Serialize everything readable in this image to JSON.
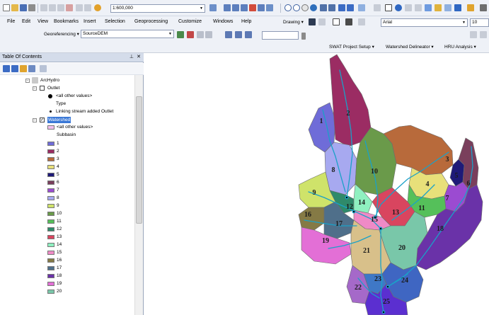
{
  "toolbar": {
    "scale": "1:600,000"
  },
  "menu": [
    "File",
    "Edit",
    "View",
    "Bookmarks",
    "Insert",
    "Selection",
    "Geoprocessing",
    "Customize",
    "Windows",
    "Help"
  ],
  "drawing": {
    "label": "Drawing ▾",
    "font": "Arial",
    "size": "10"
  },
  "georef": {
    "label": "Georeferencing ▾",
    "layer": "SourceDEM"
  },
  "swat": {
    "project_setup": "SWAT Project Setup ▾",
    "delineator": "Watershed Delineator ▾",
    "hru": "HRU Analysis ▾"
  },
  "toc": {
    "title": "Table Of Contents",
    "pin": "⊥",
    "close": "✕",
    "group": "ArcHydro",
    "outlet": {
      "name": "Outlet",
      "all_other": "<all other values>",
      "field": "Type",
      "item": "Linking stream added Outlet"
    },
    "watershed": {
      "name": "Watershed",
      "all_other": "<all other values>",
      "field": "Subbasin",
      "items": [
        {
          "label": "1",
          "color": "#6f6cd8"
        },
        {
          "label": "2",
          "color": "#9b2c63"
        },
        {
          "label": "3",
          "color": "#b86a3b"
        },
        {
          "label": "4",
          "color": "#e8e07a"
        },
        {
          "label": "5",
          "color": "#1e1a78"
        },
        {
          "label": "6",
          "color": "#7a3f5c"
        },
        {
          "label": "7",
          "color": "#9b4bd1"
        },
        {
          "label": "8",
          "color": "#a7a9f0"
        },
        {
          "label": "9",
          "color": "#cfe36a"
        },
        {
          "label": "10",
          "color": "#6a9a4a"
        },
        {
          "label": "11",
          "color": "#55c05a"
        },
        {
          "label": "12",
          "color": "#2f8a6a"
        },
        {
          "label": "13",
          "color": "#d9455f"
        },
        {
          "label": "14",
          "color": "#8ff0c0"
        },
        {
          "label": "15",
          "color": "#ef8ac6"
        },
        {
          "label": "16",
          "color": "#857a45"
        },
        {
          "label": "17",
          "color": "#4f6f8a"
        },
        {
          "label": "18",
          "color": "#6a32a8"
        },
        {
          "label": "19",
          "color": "#e36fd6"
        },
        {
          "label": "20",
          "color": "#79c7a9"
        }
      ]
    }
  },
  "map": {
    "subbasins": [
      {
        "id": "1",
        "color": "#6f6cd8"
      },
      {
        "id": "2",
        "color": "#9b2c63"
      },
      {
        "id": "3",
        "color": "#b86a3b"
      },
      {
        "id": "4",
        "color": "#e8e07a"
      },
      {
        "id": "5",
        "color": "#1e1a78"
      },
      {
        "id": "6",
        "color": "#7a3f5c"
      },
      {
        "id": "7",
        "color": "#9b4bd1"
      },
      {
        "id": "8",
        "color": "#a7a9f0"
      },
      {
        "id": "9",
        "color": "#cfe36a"
      },
      {
        "id": "10",
        "color": "#6a9a4a"
      },
      {
        "id": "11",
        "color": "#55c05a"
      },
      {
        "id": "12",
        "color": "#2f8a6a"
      },
      {
        "id": "13",
        "color": "#d9455f"
      },
      {
        "id": "14",
        "color": "#8ff0c0"
      },
      {
        "id": "15",
        "color": "#ef8ac6"
      },
      {
        "id": "16",
        "color": "#857a45"
      },
      {
        "id": "17",
        "color": "#4f6f8a"
      },
      {
        "id": "18",
        "color": "#6a32a8"
      },
      {
        "id": "19",
        "color": "#e36fd6"
      },
      {
        "id": "20",
        "color": "#79c7a9"
      },
      {
        "id": "21",
        "color": "#d8c08a"
      },
      {
        "id": "22",
        "color": "#a569c9"
      },
      {
        "id": "23",
        "color": "#3f78c6"
      },
      {
        "id": "24",
        "color": "#3f66c2"
      },
      {
        "id": "25",
        "color": "#5b2fd0"
      }
    ],
    "stream_color": "#1aa1c8"
  }
}
